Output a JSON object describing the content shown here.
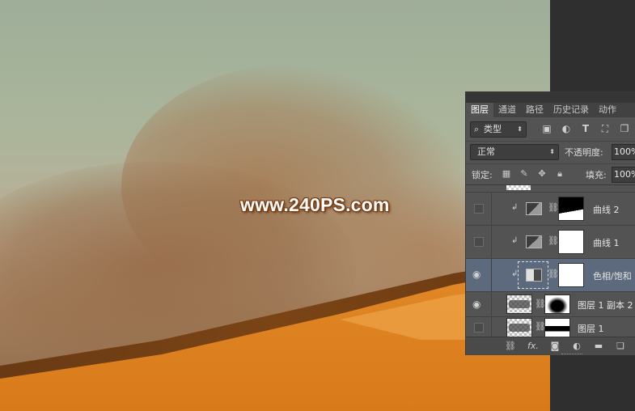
{
  "watermark": "www.240PS.com",
  "layers_panel": {
    "tabs": [
      {
        "label": "图层",
        "active": true
      },
      {
        "label": "通道",
        "active": false
      },
      {
        "label": "路径",
        "active": false
      },
      {
        "label": "历史记录",
        "active": false
      },
      {
        "label": "动作",
        "active": false
      }
    ],
    "filter": {
      "kind_label": "类型",
      "icons": [
        "image-filter-icon",
        "adjustment-filter-icon",
        "type-filter-icon",
        "shape-filter-icon",
        "smart-object-filter-icon"
      ]
    },
    "blend_mode": "正常",
    "opacity_label": "不透明度:",
    "opacity_value": "100%",
    "lock_label": "锁定:",
    "fill_label": "填充:",
    "fill_value": "100%",
    "layers": [
      {
        "name": "曲线 2",
        "visible": false,
        "clipped": true,
        "type": "curves",
        "selected": false
      },
      {
        "name": "曲线 1",
        "visible": false,
        "clipped": true,
        "type": "curves",
        "selected": false
      },
      {
        "name": "色相/饱和",
        "visible": true,
        "clipped": true,
        "type": "hue-saturation",
        "selected": true
      },
      {
        "name": "图层 1 副本 2",
        "visible": true,
        "clipped": false,
        "type": "pixel",
        "selected": false
      },
      {
        "name": "图层 1",
        "visible": false,
        "clipped": false,
        "type": "pixel",
        "selected": false
      }
    ],
    "bottom_icons": [
      "link-layers-icon",
      "fx-icon",
      "add-mask-icon",
      "adjustment-layer-icon",
      "folder-icon",
      "new-layer-icon"
    ],
    "fx_label": "fx."
  }
}
